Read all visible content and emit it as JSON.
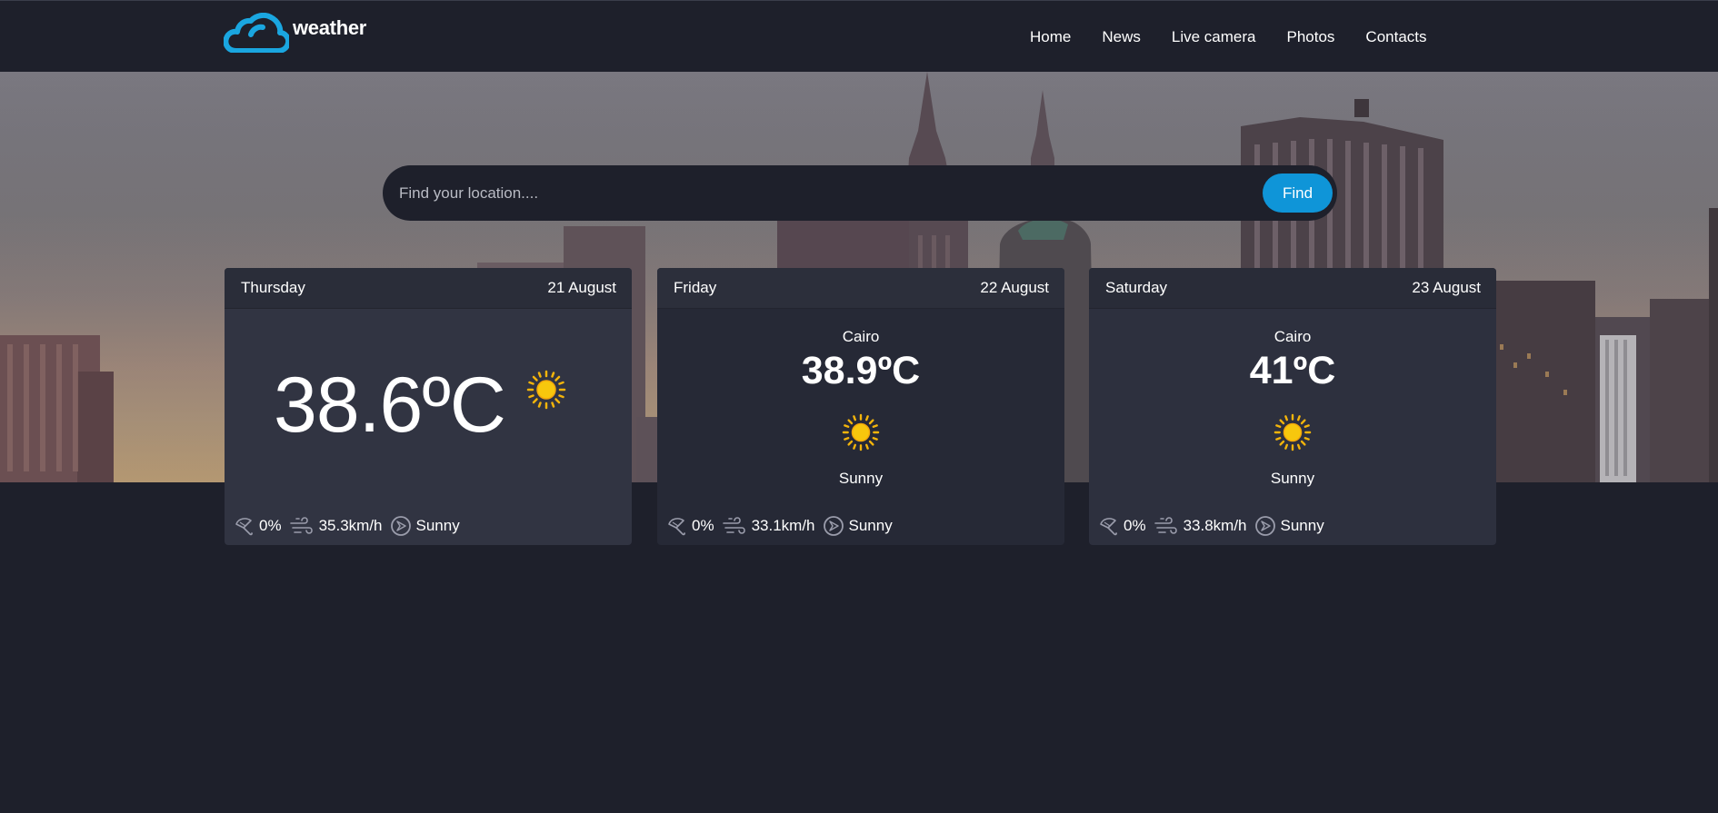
{
  "brand": {
    "name": "weather"
  },
  "nav": {
    "items": [
      "Home",
      "News",
      "Live camera",
      "Photos",
      "Contacts"
    ]
  },
  "search": {
    "placeholder": "Find your location....",
    "value": "",
    "button_label": "Find"
  },
  "forecast": [
    {
      "day": "Thursday",
      "date": "21 August",
      "temperature": "38.6ºC",
      "icon": "sun-icon",
      "rain": "0%",
      "wind": "35.3km/h",
      "direction_condition": "Sunny"
    },
    {
      "day": "Friday",
      "date": "22 August",
      "city": "Cairo",
      "temperature": "38.9ºC",
      "icon": "sun-icon",
      "condition": "Sunny",
      "rain": "0%",
      "wind": "33.1km/h",
      "direction_condition": "Sunny"
    },
    {
      "day": "Saturday",
      "date": "23 August",
      "city": "Cairo",
      "temperature": "41ºC",
      "icon": "sun-icon",
      "condition": "Sunny",
      "rain": "0%",
      "wind": "33.8km/h",
      "direction_condition": "Sunny"
    }
  ],
  "icons": {
    "rain": "umbrella-icon",
    "wind": "wind-icon",
    "compass": "compass-icon"
  },
  "colors": {
    "background": "#1e202b",
    "accent": "#0f95d8",
    "logo": "#1aa6e0",
    "sun": "#f7c70d",
    "card": "#313442"
  }
}
